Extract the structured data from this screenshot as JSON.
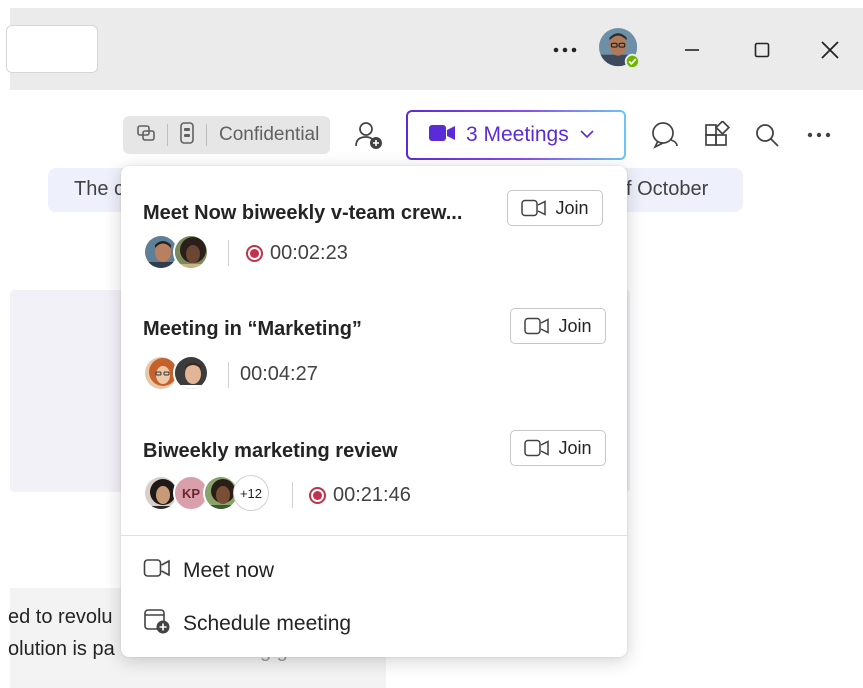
{
  "titlebar": {
    "more_icon": "more-horizontal-icon",
    "user_status": "available",
    "status_color": "#6bb700"
  },
  "header": {
    "label_pill": {
      "text": "Confidential"
    },
    "meetings_button": {
      "label": "3 Meetings",
      "accent": "#5b2bd8"
    }
  },
  "background": {
    "banner_left": "The c",
    "banner_right": "f October",
    "text_line1": "ed to revolu",
    "text_line2": "olution is pa",
    "text_line2_faded": "g  g"
  },
  "popup": {
    "meetings": [
      {
        "title": "Meet Now biweekly v-team crew...",
        "join_label": "Join",
        "participants": [
          {
            "type": "photo",
            "name": "man-glasses"
          },
          {
            "type": "photo",
            "name": "woman-curly"
          }
        ],
        "recording": true,
        "duration": "00:02:23"
      },
      {
        "title": "Meeting in “Marketing”",
        "join_label": "Join",
        "participants": [
          {
            "type": "photo",
            "name": "woman-red-hair"
          },
          {
            "type": "photo",
            "name": "man-beard"
          }
        ],
        "recording": false,
        "duration": "00:04:27"
      },
      {
        "title": "Biweekly marketing review",
        "join_label": "Join",
        "participants": [
          {
            "type": "photo",
            "name": "woman-dark-hair"
          },
          {
            "type": "initials",
            "initials": "KP"
          },
          {
            "type": "photo",
            "name": "woman-smiling"
          },
          {
            "type": "count",
            "text": "+12"
          }
        ],
        "recording": true,
        "duration": "00:21:46"
      }
    ],
    "actions": [
      {
        "label": "Meet now",
        "icon": "video-camera-icon"
      },
      {
        "label": "Schedule meeting",
        "icon": "calendar-add-icon"
      }
    ]
  }
}
